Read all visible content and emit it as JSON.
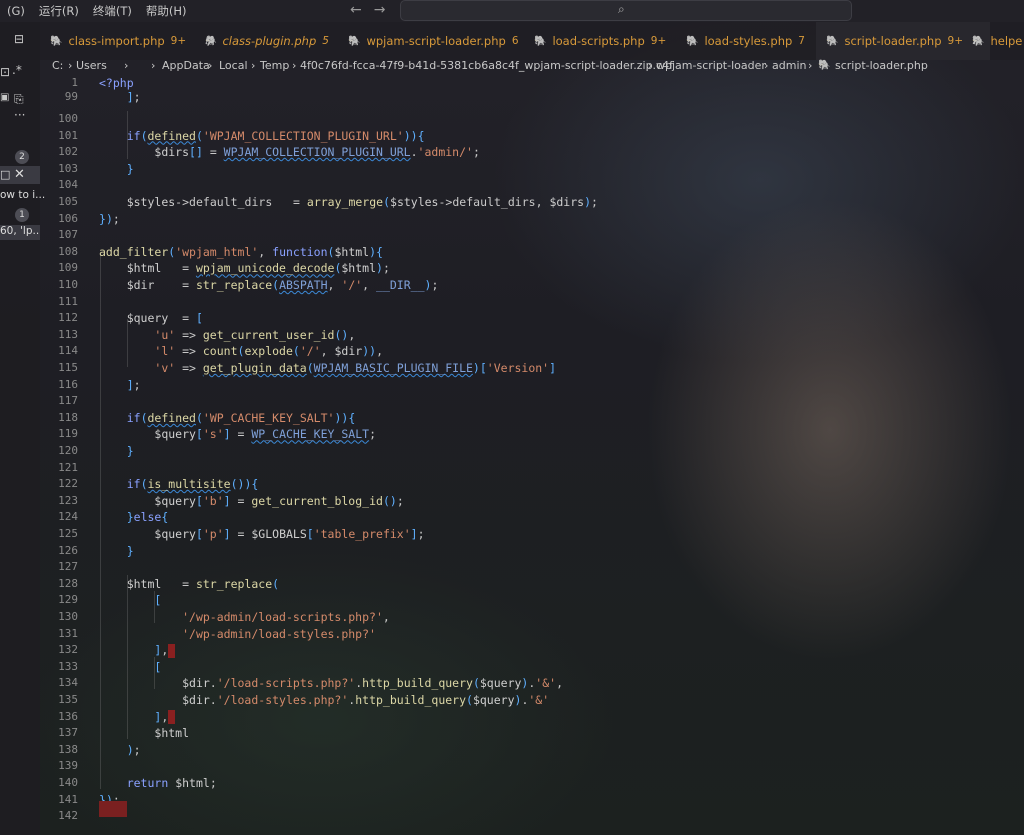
{
  "menubar": {
    "items": [
      "(G)",
      "运行(R)",
      "终端(T)",
      "帮助(H)"
    ],
    "back_icon": "arrow-left-icon",
    "forward_icon": "arrow-right-icon",
    "search_icon": "search-icon"
  },
  "activity": {
    "badge1": "2",
    "badge2": "1",
    "item1": "ow to i...",
    "item2": "60, 'lp..."
  },
  "tabs": [
    {
      "label": "class-import.php",
      "count": "9+"
    },
    {
      "label": "class-plugin.php",
      "count": "5"
    },
    {
      "label": "wpjam-script-loader.php",
      "count": "6"
    },
    {
      "label": "load-scripts.php",
      "count": "9+"
    },
    {
      "label": "load-styles.php",
      "count": "7"
    },
    {
      "label": "script-loader.php",
      "count": "9+"
    },
    {
      "label": "helpe",
      "count": ""
    }
  ],
  "breadcrumb": {
    "parts": [
      "C:",
      "Users",
      "AppData",
      "Local",
      "Temp",
      "4f0c76fd-fcca-47f9-b41d-5381cb6a8c4f_wpjam-script-loader.zip.c4f",
      "wpjam-script-loader",
      "admin",
      "script-loader.php"
    ]
  },
  "editor": {
    "line_numbers": [
      "1",
      "99",
      "100",
      "101",
      "102",
      "103",
      "104",
      "105",
      "106",
      "107",
      "108",
      "109",
      "110",
      "111",
      "112",
      "113",
      "114",
      "115",
      "116",
      "117",
      "118",
      "119",
      "120",
      "121",
      "122",
      "123",
      "124",
      "125",
      "126",
      "127",
      "128",
      "129",
      "130",
      "131",
      "132",
      "133",
      "134",
      "135",
      "136",
      "137",
      "138",
      "139",
      "140",
      "141",
      "142"
    ],
    "lines": [
      "<?php",
      "    ];",
      "",
      "    if(defined('WPJAM_COLLECTION_PLUGIN_URL')){",
      "        $dirs[] = WPJAM_COLLECTION_PLUGIN_URL.'admin/';",
      "    }",
      "",
      "    $styles->default_dirs   = array_merge($styles->default_dirs, $dirs);",
      "});",
      "",
      "add_filter('wpjam_html', function($html){",
      "    $html   = wpjam_unicode_decode($html);",
      "    $dir    = str_replace(ABSPATH, '/', __DIR__);",
      "",
      "    $query  = [",
      "        'u' => get_current_user_id(),",
      "        'l' => count(explode('/', $dir)),",
      "        'v' => get_plugin_data(WPJAM_BASIC_PLUGIN_FILE)['Version']",
      "    ];",
      "",
      "    if(defined('WP_CACHE_KEY_SALT')){",
      "        $query['s'] = WP_CACHE_KEY_SALT;",
      "    }",
      "",
      "    if(is_multisite()){",
      "        $query['b'] = get_current_blog_id();",
      "    }else{",
      "        $query['p'] = $GLOBALS['table_prefix'];",
      "    }",
      "",
      "    $html   = str_replace(",
      "        [",
      "            '/wp-admin/load-scripts.php?',",
      "            '/wp-admin/load-styles.php?'",
      "        ],",
      "        [",
      "            $dir.'/load-scripts.php?'.http_build_query($query).'&',",
      "            $dir.'/load-styles.php?'.http_build_query($query).'&'",
      "        ],",
      "        $html",
      "    );",
      "",
      "    return $html;",
      "});",
      ""
    ]
  }
}
